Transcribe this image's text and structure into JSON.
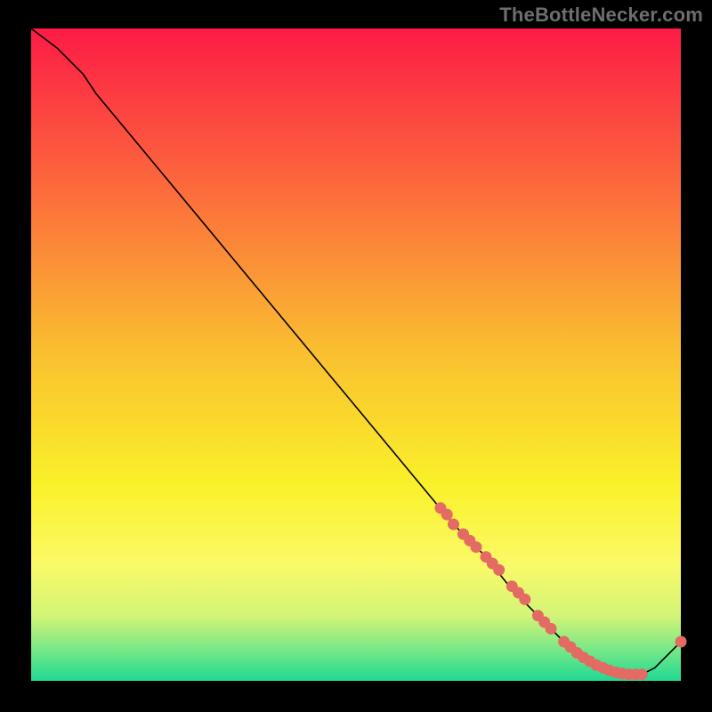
{
  "watermark": "TheBottleNecker.com",
  "colors": {
    "black": "#000000",
    "line": "#000000",
    "marker": "#e46a64",
    "watermark": "#6e6e6e"
  },
  "chart_data": {
    "type": "line",
    "title": "",
    "xlabel": "",
    "ylabel": "",
    "xlim": [
      0,
      100
    ],
    "ylim": [
      0,
      100
    ],
    "grid": false,
    "legend": false,
    "background_gradient": {
      "direction": "vertical",
      "stops": [
        {
          "pos": 0.0,
          "color": "#fd1b46"
        },
        {
          "pos": 0.25,
          "color": "#fc6c3c"
        },
        {
          "pos": 0.5,
          "color": "#fac030"
        },
        {
          "pos": 0.7,
          "color": "#faf12a"
        },
        {
          "pos": 0.82,
          "color": "#fbfa67"
        },
        {
          "pos": 0.9,
          "color": "#d3f477"
        },
        {
          "pos": 0.95,
          "color": "#7ce886"
        },
        {
          "pos": 1.0,
          "color": "#1fd993"
        }
      ]
    },
    "series": [
      {
        "name": "curve",
        "type": "line",
        "x": [
          0,
          4,
          8,
          10,
          15,
          20,
          25,
          30,
          35,
          40,
          45,
          50,
          55,
          60,
          65,
          70,
          74,
          78,
          80,
          82,
          84,
          86,
          88,
          90,
          92,
          94,
          96,
          98,
          100
        ],
        "y": [
          100,
          97,
          93,
          90,
          84,
          78,
          72,
          66,
          60,
          54,
          48,
          42,
          36,
          30,
          24,
          19,
          14,
          10,
          8,
          6,
          4,
          3,
          2,
          1,
          1,
          1,
          2,
          4,
          6
        ]
      },
      {
        "name": "markers",
        "type": "scatter",
        "x": [
          63,
          64,
          65,
          66.5,
          67.5,
          68.5,
          70,
          71,
          72,
          74,
          75,
          76,
          78,
          79,
          80,
          82,
          83,
          84,
          85,
          86,
          87,
          88,
          89,
          90,
          91,
          92,
          93,
          94,
          100
        ],
        "y": [
          26.5,
          25.5,
          24,
          22.5,
          21.5,
          20.5,
          19,
          18,
          17,
          14.5,
          13.5,
          12.5,
          10,
          9,
          8,
          6,
          5.2,
          4.3,
          3.6,
          3,
          2.4,
          2,
          1.6,
          1.3,
          1.1,
          1,
          1,
          1,
          6
        ]
      }
    ]
  }
}
